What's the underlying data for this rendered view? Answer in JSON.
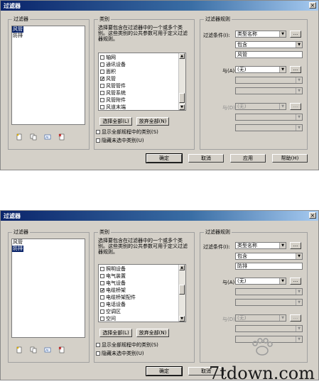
{
  "dialogs": [
    {
      "title": "过滤器",
      "filters_group": "过滤器",
      "filters": [
        {
          "label": "风管",
          "selected": true
        },
        {
          "label": "防排",
          "selected": false
        }
      ],
      "categories_group": "类别",
      "description": "选择要包含在过滤器中的一个或多个类别。这些类别的公共参数可用于定义过滤器规则。",
      "categories": [
        {
          "label": "轴网",
          "checked": false
        },
        {
          "label": "通讯设备",
          "checked": false
        },
        {
          "label": "面积",
          "checked": false
        },
        {
          "label": "风管",
          "checked": true
        },
        {
          "label": "风管管件",
          "checked": false
        },
        {
          "label": "风管系统",
          "checked": false
        },
        {
          "label": "风管附件",
          "checked": false
        },
        {
          "label": "风道末端",
          "checked": false
        }
      ],
      "select_all": "选择全部(L)",
      "deselect_all": "放弃全部(N)",
      "show_all": "显示全部规程中的类别(S)",
      "hide_unchecked": "隐藏未选中类别(U)",
      "rules_group": "过滤器规则",
      "condition_label": "过滤条件(I):",
      "condition_param": "类型名称",
      "condition_operator": "包含",
      "condition_value": "风管",
      "and_label_1": "与(A):",
      "and_value_1": "(无)",
      "and_label_2": "与(D):",
      "and_value_2": "(无)",
      "dots": "...",
      "ok": "确定",
      "cancel": "取消",
      "apply": "应用",
      "help": "帮助(H)",
      "close": "×"
    },
    {
      "title": "过滤器",
      "filters_group": "过滤器",
      "filters": [
        {
          "label": "风管",
          "selected": false
        },
        {
          "label": "防排",
          "selected": true
        }
      ],
      "categories_group": "类别",
      "description": "选择要包含在过滤器中的一个或多个类别。这些类别的公共参数可用于定义过滤器规则。",
      "categories": [
        {
          "label": "照明设备",
          "checked": false
        },
        {
          "label": "电气装置",
          "checked": false
        },
        {
          "label": "电气设备",
          "checked": false
        },
        {
          "label": "电缆桥架",
          "checked": true
        },
        {
          "label": "电缆桥架配件",
          "checked": false
        },
        {
          "label": "电话设备",
          "checked": false
        },
        {
          "label": "空调区",
          "checked": false
        },
        {
          "label": "空间",
          "checked": false
        }
      ],
      "select_all": "选择全部(L)",
      "deselect_all": "放弃全部(N)",
      "show_all": "显示全部规程中的类别(S)",
      "hide_unchecked": "隐藏未选中类别(U)",
      "rules_group": "过滤器规则",
      "condition_label": "过滤条件(I):",
      "condition_param": "类型名称",
      "condition_operator": "包含",
      "condition_value": "防排",
      "and_label_1": "与(A):",
      "and_value_1": "(无)",
      "and_label_2": "与(D):",
      "and_value_2": "(无)",
      "dots": "...",
      "ok": "确定",
      "cancel": "取消",
      "close": "×"
    }
  ],
  "watermark": "7tdown.com",
  "icons": [
    "new-filter-icon",
    "copy-filter-icon",
    "rename-filter-icon",
    "delete-filter-icon"
  ]
}
